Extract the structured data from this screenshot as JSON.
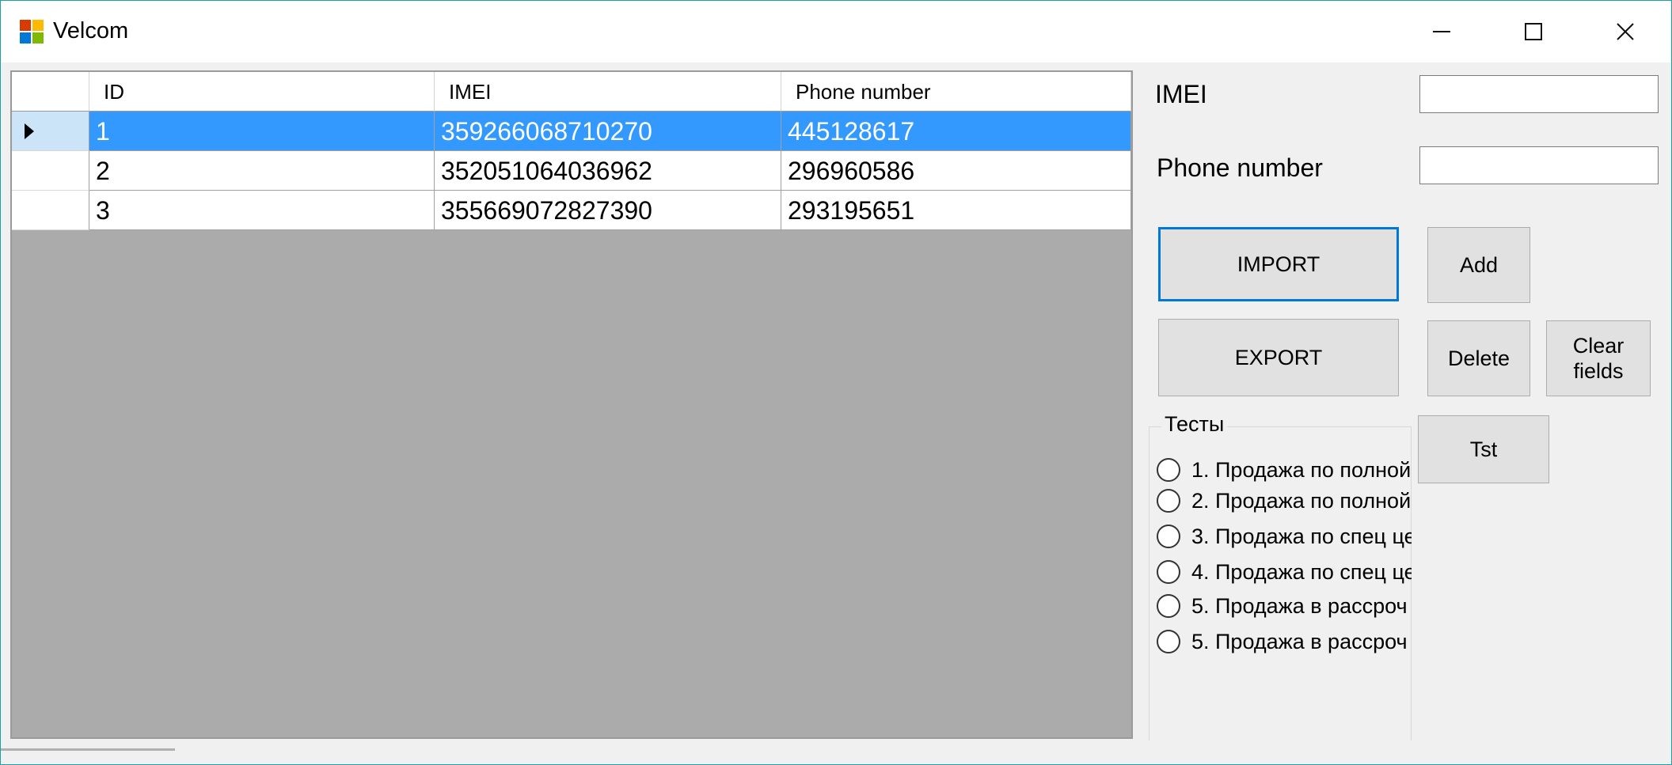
{
  "window": {
    "title": "Velcom",
    "controls": {
      "minimize": "—",
      "maximize": "☐",
      "close": "✕"
    }
  },
  "grid": {
    "columns": [
      "ID",
      "IMEI",
      "Phone number"
    ],
    "rows": [
      {
        "id": "1",
        "imei": "359266068710270",
        "phone": "445128617",
        "selected": true
      },
      {
        "id": "2",
        "imei": "352051064036962",
        "phone": "296960586",
        "selected": false
      },
      {
        "id": "3",
        "imei": "355669072827390",
        "phone": "293195651",
        "selected": false
      }
    ]
  },
  "form": {
    "imei_label": "IMEI",
    "imei_value": "",
    "phone_label": "Phone number",
    "phone_value": ""
  },
  "buttons": {
    "import": "IMPORT",
    "add": "Add",
    "export": "EXPORT",
    "delete": "Delete",
    "clear_fields": "Clear fields",
    "tst": "Tst"
  },
  "tests": {
    "title": "Тесты",
    "options": [
      "1. Продажа по полной",
      "2. Продажа по полной",
      "3. Продажа по спец це",
      "4. Продажа по спец це",
      "5. Продажа в рассроч",
      "5. Продажа в рассроч"
    ]
  },
  "colors": {
    "selection": "#3399ff",
    "focus_border": "#0078d7",
    "grid_background": "#ababab",
    "window_border": "#1aa0a8"
  }
}
